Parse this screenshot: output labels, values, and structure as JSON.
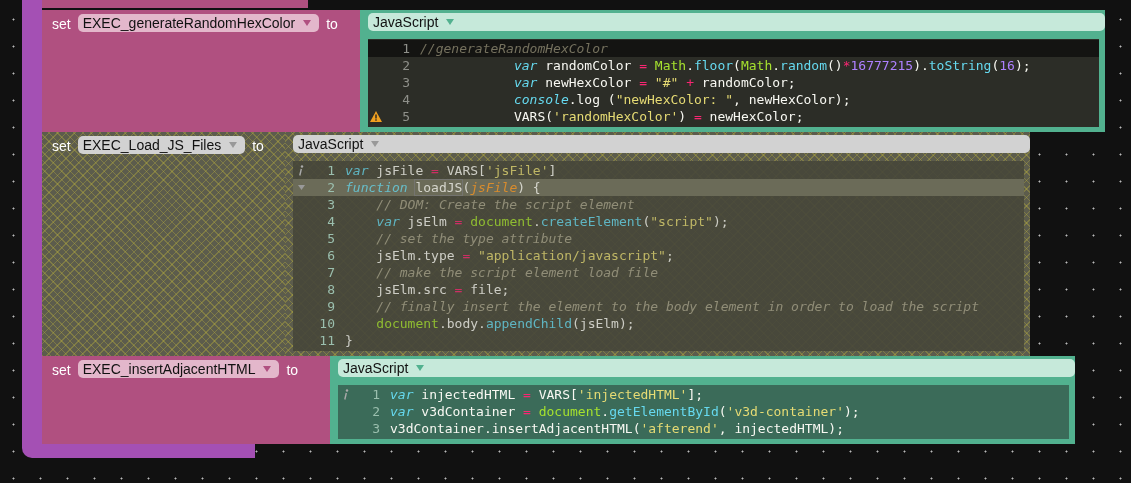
{
  "blocks": [
    {
      "set_label": "set",
      "variable": "EXEC_generateRandomHexColor",
      "to_label": "to",
      "language": "JavaScript",
      "disabled": false,
      "focused": true,
      "lines": [
        {
          "number": "1",
          "kind": "plain",
          "active": true,
          "tokens": [
            {
              "kind": "comment",
              "text": "//generateRandomHexColor"
            }
          ]
        },
        {
          "number": "2",
          "kind": "plain",
          "active": false,
          "tokens": [
            {
              "kind": "keyword",
              "text": "            var"
            },
            {
              "kind": "plain",
              "text": " randomColor "
            },
            {
              "kind": "operator",
              "text": "= "
            },
            {
              "kind": "object",
              "text": "Math"
            },
            {
              "kind": "plain",
              "text": "."
            },
            {
              "kind": "function",
              "text": "floor"
            },
            {
              "kind": "plain",
              "text": "("
            },
            {
              "kind": "object",
              "text": "Math"
            },
            {
              "kind": "plain",
              "text": "."
            },
            {
              "kind": "function",
              "text": "random"
            },
            {
              "kind": "plain",
              "text": "()"
            },
            {
              "kind": "operator",
              "text": "*"
            },
            {
              "kind": "number",
              "text": "16777215"
            },
            {
              "kind": "plain",
              "text": ")."
            },
            {
              "kind": "function",
              "text": "toString"
            },
            {
              "kind": "plain",
              "text": "("
            },
            {
              "kind": "number",
              "text": "16"
            },
            {
              "kind": "plain",
              "text": ");"
            }
          ]
        },
        {
          "number": "3",
          "kind": "plain",
          "active": false,
          "tokens": [
            {
              "kind": "keyword",
              "text": "            var"
            },
            {
              "kind": "plain",
              "text": " newHexColor "
            },
            {
              "kind": "operator",
              "text": "= "
            },
            {
              "kind": "string",
              "text": "\"#\" "
            },
            {
              "kind": "operator",
              "text": "+"
            },
            {
              "kind": "plain",
              "text": " randomColor;"
            }
          ]
        },
        {
          "number": "4",
          "kind": "plain",
          "active": false,
          "tokens": [
            {
              "kind": "keyword",
              "text": "            console"
            },
            {
              "kind": "plain",
              "text": ".log ("
            },
            {
              "kind": "string",
              "text": "\"newHexColor: \""
            },
            {
              "kind": "plain",
              "text": ", newHexColor);"
            }
          ]
        },
        {
          "number": "5",
          "kind": "warning",
          "active": false,
          "tokens": [
            {
              "kind": "plain",
              "text": "            VARS("
            },
            {
              "kind": "string",
              "text": "'randomHexColor'"
            },
            {
              "kind": "plain",
              "text": ") "
            },
            {
              "kind": "operator",
              "text": "="
            },
            {
              "kind": "plain",
              "text": " newHexColor;"
            }
          ]
        }
      ]
    },
    {
      "set_label": "set",
      "variable": "EXEC_Load_JS_Files",
      "to_label": "to",
      "language": "JavaScript",
      "disabled": true,
      "focused": false,
      "lines": [
        {
          "number": "1",
          "kind": "info",
          "active": false,
          "tokens": [
            {
              "kind": "keyword",
              "text": "var"
            },
            {
              "kind": "plain",
              "text": " jsFile "
            },
            {
              "kind": "operator",
              "text": "="
            },
            {
              "kind": "plain",
              "text": " VARS["
            },
            {
              "kind": "string",
              "text": "'jsFile'"
            },
            {
              "kind": "plain",
              "text": "]"
            }
          ]
        },
        {
          "number": "2",
          "kind": "fold",
          "active": true,
          "tokens": [
            {
              "kind": "keyword",
              "text": "function "
            },
            {
              "kind": "match",
              "text": "loadJS"
            },
            {
              "kind": "plain",
              "text": "("
            },
            {
              "kind": "param",
              "text": "jsFile"
            },
            {
              "kind": "plain",
              "text": ") {"
            }
          ]
        },
        {
          "number": "3",
          "kind": "plain",
          "active": false,
          "tokens": [
            {
              "kind": "comment",
              "text": "    // DOM: Create the script element"
            }
          ]
        },
        {
          "number": "4",
          "kind": "plain",
          "active": false,
          "tokens": [
            {
              "kind": "keyword",
              "text": "    var"
            },
            {
              "kind": "plain",
              "text": " jsElm "
            },
            {
              "kind": "operator",
              "text": "= "
            },
            {
              "kind": "object",
              "text": "document"
            },
            {
              "kind": "plain",
              "text": "."
            },
            {
              "kind": "function",
              "text": "createElement"
            },
            {
              "kind": "plain",
              "text": "("
            },
            {
              "kind": "string",
              "text": "\"script\""
            },
            {
              "kind": "plain",
              "text": ");"
            }
          ]
        },
        {
          "number": "5",
          "kind": "plain",
          "active": false,
          "tokens": [
            {
              "kind": "comment",
              "text": "    // set the type attribute"
            }
          ]
        },
        {
          "number": "6",
          "kind": "plain",
          "active": false,
          "tokens": [
            {
              "kind": "plain",
              "text": "    jsElm.type "
            },
            {
              "kind": "operator",
              "text": "= "
            },
            {
              "kind": "string",
              "text": "\"application/javascript\""
            },
            {
              "kind": "plain",
              "text": ";"
            }
          ]
        },
        {
          "number": "7",
          "kind": "plain",
          "active": false,
          "tokens": [
            {
              "kind": "comment",
              "text": "    // make the script element load file"
            }
          ]
        },
        {
          "number": "8",
          "kind": "plain",
          "active": false,
          "tokens": [
            {
              "kind": "plain",
              "text": "    jsElm.src "
            },
            {
              "kind": "operator",
              "text": "="
            },
            {
              "kind": "plain",
              "text": " file;"
            }
          ]
        },
        {
          "number": "9",
          "kind": "plain",
          "active": false,
          "tokens": [
            {
              "kind": "comment",
              "text": "    // finally insert the element to the body element in order to load the script"
            }
          ]
        },
        {
          "number": "10",
          "kind": "plain",
          "active": false,
          "tokens": [
            {
              "kind": "object",
              "text": "    document"
            },
            {
              "kind": "plain",
              "text": ".body."
            },
            {
              "kind": "function",
              "text": "appendChild"
            },
            {
              "kind": "plain",
              "text": "(jsElm);"
            }
          ]
        },
        {
          "number": "11",
          "kind": "plain",
          "active": false,
          "tokens": [
            {
              "kind": "plain",
              "text": "}"
            }
          ]
        }
      ]
    },
    {
      "set_label": "set",
      "variable": "EXEC_insertAdjacentHTML",
      "to_label": "to",
      "language": "JavaScript",
      "disabled": false,
      "focused": false,
      "lines": [
        {
          "number": "1",
          "kind": "info",
          "active": false,
          "tokens": [
            {
              "kind": "keyword",
              "text": "var"
            },
            {
              "kind": "plain",
              "text": " injectedHTML "
            },
            {
              "kind": "operator",
              "text": "="
            },
            {
              "kind": "plain",
              "text": " VARS["
            },
            {
              "kind": "string",
              "text": "'injectedHTML'"
            },
            {
              "kind": "plain",
              "text": "];"
            }
          ]
        },
        {
          "number": "2",
          "kind": "plain",
          "active": false,
          "tokens": [
            {
              "kind": "keyword",
              "text": "var"
            },
            {
              "kind": "plain",
              "text": " v3dContainer "
            },
            {
              "kind": "operator",
              "text": "= "
            },
            {
              "kind": "object",
              "text": "document"
            },
            {
              "kind": "plain",
              "text": "."
            },
            {
              "kind": "function",
              "text": "getElementById"
            },
            {
              "kind": "plain",
              "text": "("
            },
            {
              "kind": "string",
              "text": "'v3d-container'"
            },
            {
              "kind": "plain",
              "text": ");"
            }
          ]
        },
        {
          "number": "3",
          "kind": "plain",
          "active": false,
          "tokens": [
            {
              "kind": "plain",
              "text": "v3dContainer.insertAdjacentHTML("
            },
            {
              "kind": "string",
              "text": "'afterend'"
            },
            {
              "kind": "plain",
              "text": ", injectedHTML);"
            }
          ]
        }
      ]
    }
  ]
}
